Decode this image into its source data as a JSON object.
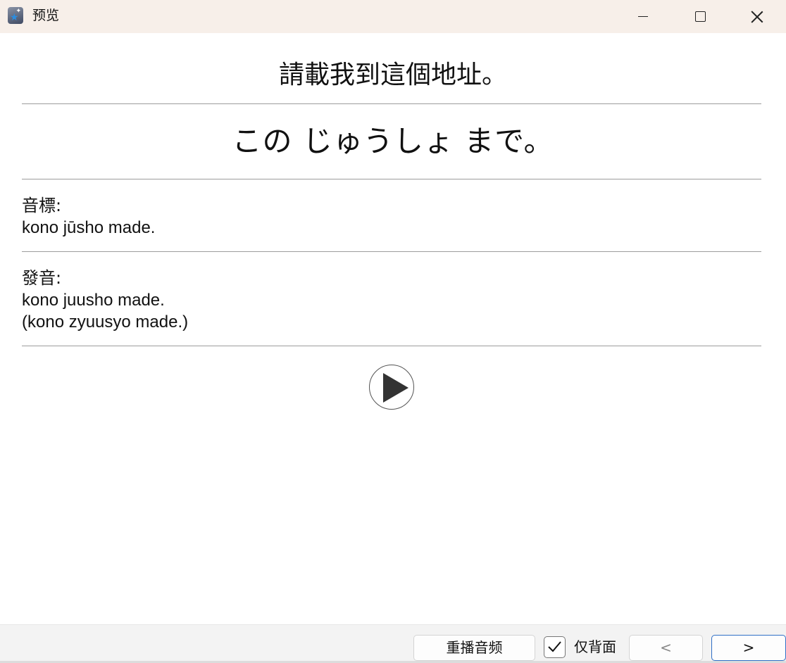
{
  "window": {
    "title": "预览"
  },
  "card": {
    "front": "請載我到這個地址。",
    "kana": "この じゅうしょ まで。",
    "phonetic": {
      "label": "音標:",
      "value": "kono jūsho made."
    },
    "pronunciation": {
      "label": "發音:",
      "line1": "kono juusho made.",
      "line2": "(kono zyuusyo made.)"
    }
  },
  "toolbar": {
    "replay_label": "重播音频",
    "back_only_label": "仅背面",
    "back_only_checked": true,
    "prev_label": "<",
    "next_label": ">"
  },
  "icons": {
    "play": "play-icon",
    "minimize": "minimize-icon",
    "maximize": "maximize-icon",
    "close": "close-icon",
    "app": "app-icon"
  },
  "colors": {
    "titlebar_bg": "#f7efe9",
    "accent": "#2f6fc6",
    "divider": "#9c9c9c"
  }
}
